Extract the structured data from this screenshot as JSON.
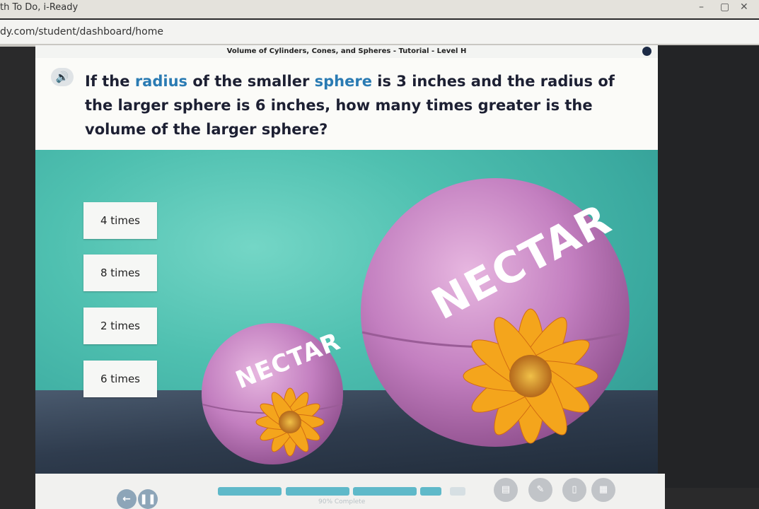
{
  "window": {
    "title": "th To Do, i-Ready",
    "minimize_icon": "minimize-icon",
    "maximize_icon": "maximize-icon",
    "close_icon": "close-icon"
  },
  "browser": {
    "url": "dy.com/student/dashboard/home"
  },
  "lesson": {
    "title": "Volume of Cylinders, Cones, and Spheres - Tutorial - Level H",
    "question_parts": {
      "p1": "If the ",
      "k1": "radius",
      "p2": " of the smaller ",
      "k2": "sphere",
      "p3": " is 3 inches and the radius of the larger sphere is 6 inches, how many times greater is the volume of the larger sphere?"
    },
    "keyword_color": "#2a7bb3"
  },
  "choices": [
    {
      "label": "4 times"
    },
    {
      "label": "8 times"
    },
    {
      "label": "2 times"
    },
    {
      "label": "6 times"
    }
  ],
  "scene": {
    "small_ball_brand": "NECTAR",
    "large_ball_brand": "NECTAR",
    "ball_color": "#c37fc0",
    "flower_color": "#f4a51c"
  },
  "footer": {
    "progress_text": "90% Complete",
    "progress_fraction": 0.9
  }
}
